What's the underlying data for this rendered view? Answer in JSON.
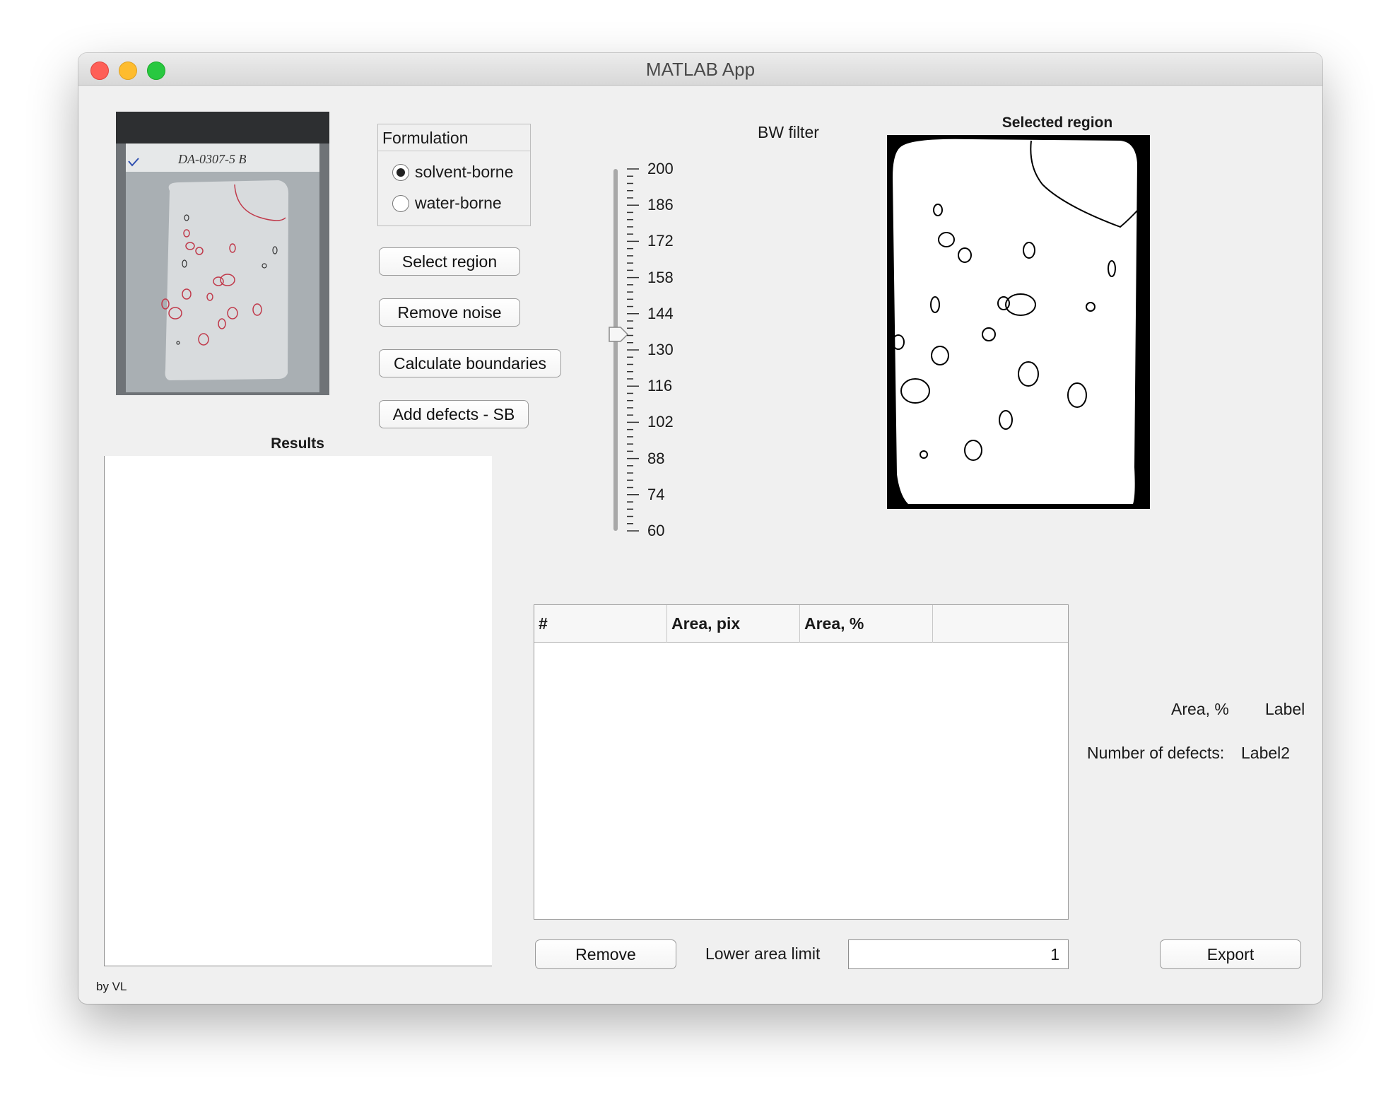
{
  "window": {
    "title": "MATLAB App"
  },
  "photo": {
    "note_text": "DA-0307-5 B"
  },
  "formulation": {
    "title": "Formulation",
    "options": [
      "solvent-borne",
      "water-borne"
    ],
    "selected": "solvent-borne"
  },
  "buttons": {
    "select_region": "Select region",
    "remove_noise": "Remove noise",
    "calculate_boundaries": "Calculate boundaries",
    "add_defects": "Add defects - SB",
    "remove": "Remove",
    "export": "Export"
  },
  "bw_filter": {
    "label": "BW filter",
    "ticks": [
      "200",
      "186",
      "172",
      "158",
      "144",
      "130",
      "116",
      "102",
      "88",
      "74",
      "60"
    ],
    "value": 136
  },
  "selected_region": {
    "title": "Selected region"
  },
  "results": {
    "title": "Results"
  },
  "table": {
    "columns": [
      "#",
      "Area, pix",
      "Area, %",
      ""
    ],
    "rows": []
  },
  "stats": {
    "area_percent_label": "Area, %",
    "area_percent_value": "Label",
    "defects_label": "Number of defects:",
    "defects_value": "Label2"
  },
  "lower_area": {
    "label": "Lower area limit",
    "value": "1"
  },
  "footer": {
    "credit": "by VL"
  }
}
